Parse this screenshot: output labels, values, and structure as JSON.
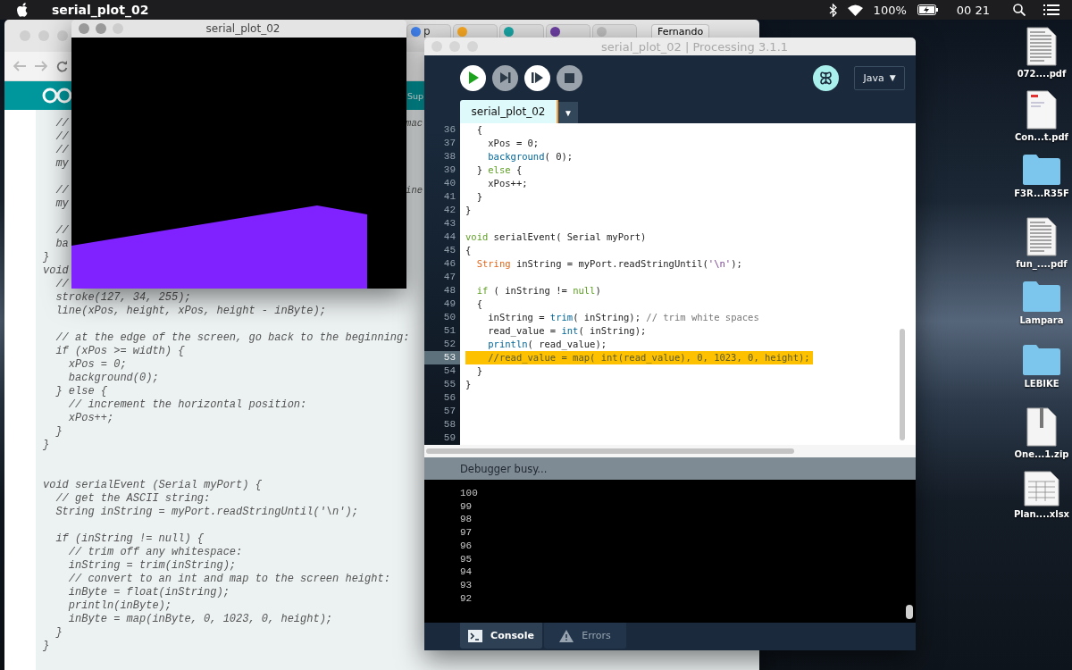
{
  "menu_bar": {
    "app_name": "serial_plot_02",
    "battery_text": "100%",
    "clock": "00 21"
  },
  "browser": {
    "tabs": [
      {
        "kind": "google",
        "text": "p"
      },
      {
        "kind": "bookmark"
      },
      {
        "kind": "circle"
      },
      {
        "kind": "profile"
      },
      {
        "kind": "document"
      }
    ],
    "profile": "Fernando",
    "header_link": "Sup",
    "code_lines": [
      {
        "kind": "code",
        "text": "  //",
        "right": "mac"
      },
      {
        "kind": "code",
        "text": "  //"
      },
      {
        "kind": "code",
        "text": "  //"
      },
      {
        "kind": "code",
        "text": "  my"
      },
      {
        "kind": "blank"
      },
      {
        "kind": "code",
        "text": "  //",
        "right": "ine"
      },
      {
        "kind": "code",
        "text": "  my"
      },
      {
        "kind": "blank"
      },
      {
        "kind": "code",
        "text": "  //"
      },
      {
        "kind": "code",
        "text": "  ba"
      },
      {
        "kind": "code",
        "text": "}"
      },
      {
        "kind": "code",
        "text": "void"
      },
      {
        "kind": "code",
        "text": "  //"
      },
      {
        "kind": "code",
        "text": "  stroke(127, 34, 255);"
      },
      {
        "kind": "code",
        "text": "  line(xPos, height, xPos, height - inByte);"
      },
      {
        "kind": "blank"
      },
      {
        "kind": "code",
        "text": "  // at the edge of the screen, go back to the beginning:"
      },
      {
        "kind": "code",
        "text": "  if (xPos >= width) {"
      },
      {
        "kind": "code",
        "text": "    xPos = 0;"
      },
      {
        "kind": "code",
        "text": "    background(0);"
      },
      {
        "kind": "code",
        "text": "  } else {"
      },
      {
        "kind": "code",
        "text": "    // increment the horizontal position:"
      },
      {
        "kind": "code",
        "text": "    xPos++;"
      },
      {
        "kind": "code",
        "text": "  }"
      },
      {
        "kind": "code",
        "text": "}"
      },
      {
        "kind": "blank"
      },
      {
        "kind": "blank"
      },
      {
        "kind": "code",
        "text": "void serialEvent (Serial myPort) {"
      },
      {
        "kind": "code",
        "text": "  // get the ASCII string:"
      },
      {
        "kind": "code",
        "text": "  String inString = myPort.readStringUntil('\\n');"
      },
      {
        "kind": "blank"
      },
      {
        "kind": "code",
        "text": "  if (inString != null) {"
      },
      {
        "kind": "code",
        "text": "    // trim off any whitespace:"
      },
      {
        "kind": "code",
        "text": "    inString = trim(inString);"
      },
      {
        "kind": "code",
        "text": "    // convert to an int and map to the screen height:"
      },
      {
        "kind": "code",
        "text": "    inByte = float(inString);"
      },
      {
        "kind": "code",
        "text": "    println(inByte);"
      },
      {
        "kind": "code",
        "text": "    inByte = map(inByte, 0, 1023, 0, height);"
      },
      {
        "kind": "code",
        "text": "  }"
      },
      {
        "kind": "code",
        "text": "}"
      }
    ]
  },
  "sketch_window": {
    "title": "serial_plot_02"
  },
  "processing": {
    "title": "serial_plot_02 | Processing 3.1.1",
    "toolbar": [
      {
        "kind": "run",
        "enabled": true
      },
      {
        "kind": "step",
        "enabled": false
      },
      {
        "kind": "continue",
        "enabled": true
      },
      {
        "kind": "stop",
        "enabled": false
      }
    ],
    "mode": "Java",
    "mode_caret": "▼",
    "tab": "serial_plot_02",
    "tab_menu": "▼",
    "lines": [
      {
        "number": "36",
        "segments": [
          {
            "kind": "plain",
            "text": "  {"
          }
        ]
      },
      {
        "number": "37",
        "segments": [
          {
            "kind": "plain",
            "text": "    xPos = 0;"
          }
        ]
      },
      {
        "number": "38",
        "segments": [
          {
            "kind": "function",
            "text": "    background"
          },
          {
            "kind": "plain",
            "text": "( 0);"
          }
        ]
      },
      {
        "number": "39",
        "segments": [
          {
            "kind": "plain",
            "text": "  } "
          },
          {
            "kind": "keyword",
            "text": "else"
          },
          {
            "kind": "plain",
            "text": " {"
          }
        ]
      },
      {
        "number": "40",
        "segments": [
          {
            "kind": "plain",
            "text": "    xPos++;"
          }
        ]
      },
      {
        "number": "41",
        "segments": [
          {
            "kind": "plain",
            "text": "  }"
          }
        ]
      },
      {
        "number": "42",
        "segments": [
          {
            "kind": "plain",
            "text": "}"
          }
        ]
      },
      {
        "number": "43"
      },
      {
        "number": "44",
        "segments": [
          {
            "kind": "keyword",
            "text": "void"
          },
          {
            "kind": "plain",
            "text": " serialEvent( Serial myPort)"
          }
        ]
      },
      {
        "number": "45",
        "segments": [
          {
            "kind": "plain",
            "text": "{"
          }
        ]
      },
      {
        "number": "46",
        "segments": [
          {
            "kind": "type",
            "text": "  String"
          },
          {
            "kind": "plain",
            "text": " inString = myPort.readStringUntil("
          },
          {
            "kind": "string",
            "text": "'\\n'"
          },
          {
            "kind": "plain",
            "text": ");"
          }
        ]
      },
      {
        "number": "47"
      },
      {
        "number": "48",
        "segments": [
          {
            "kind": "keyword",
            "text": "  if"
          },
          {
            "kind": "plain",
            "text": " ( inString != "
          },
          {
            "kind": "keyword",
            "text": "null"
          },
          {
            "kind": "plain",
            "text": ")"
          }
        ]
      },
      {
        "number": "49",
        "segments": [
          {
            "kind": "plain",
            "text": "  {"
          }
        ]
      },
      {
        "number": "50",
        "segments": [
          {
            "kind": "plain",
            "text": "    inString = "
          },
          {
            "kind": "function",
            "text": "trim"
          },
          {
            "kind": "plain",
            "text": "( inString); "
          },
          {
            "kind": "comment",
            "text": "// trim white spaces"
          }
        ]
      },
      {
        "number": "51",
        "segments": [
          {
            "kind": "plain",
            "text": "    read_value = "
          },
          {
            "kind": "function",
            "text": "int"
          },
          {
            "kind": "plain",
            "text": "( inString);"
          }
        ]
      },
      {
        "number": "52",
        "segments": [
          {
            "kind": "function",
            "text": "    println"
          },
          {
            "kind": "plain",
            "text": "( read_value);"
          }
        ]
      },
      {
        "number": "53",
        "highlighted": true,
        "segments": [
          {
            "kind": "comment",
            "text": "    //read_value = map( int(read_value), 0, 1023, 0, height);"
          }
        ]
      },
      {
        "number": "54",
        "segments": [
          {
            "kind": "plain",
            "text": "  }"
          }
        ]
      },
      {
        "number": "55",
        "segments": [
          {
            "kind": "plain",
            "text": "}"
          }
        ]
      },
      {
        "number": "56"
      },
      {
        "number": "57"
      },
      {
        "number": "58"
      },
      {
        "number": "59"
      }
    ],
    "status": "Debugger busy...",
    "console": [
      "100",
      "99",
      "98",
      "97",
      "96",
      "95",
      "94",
      "93",
      "92"
    ],
    "bottom_tabs": [
      {
        "label": "Console",
        "kind": "console",
        "selected": true
      },
      {
        "label": "Errors",
        "kind": "errors",
        "selected": false
      }
    ]
  },
  "desktop_icons": [
    {
      "label": "072....pdf",
      "kind": "document"
    },
    {
      "label": "Con...t.pdf",
      "kind": "pdf"
    },
    {
      "label": "F3R...R35F",
      "kind": "folder"
    },
    {
      "label": "fun_....pdf",
      "kind": "document"
    },
    {
      "label": "Lampara",
      "kind": "folder"
    },
    {
      "label": "LEBIKE",
      "kind": "folder"
    },
    {
      "label": "One...1.zip",
      "kind": "zip"
    },
    {
      "label": "Plan....xlsx",
      "kind": "spreadsheet"
    }
  ]
}
